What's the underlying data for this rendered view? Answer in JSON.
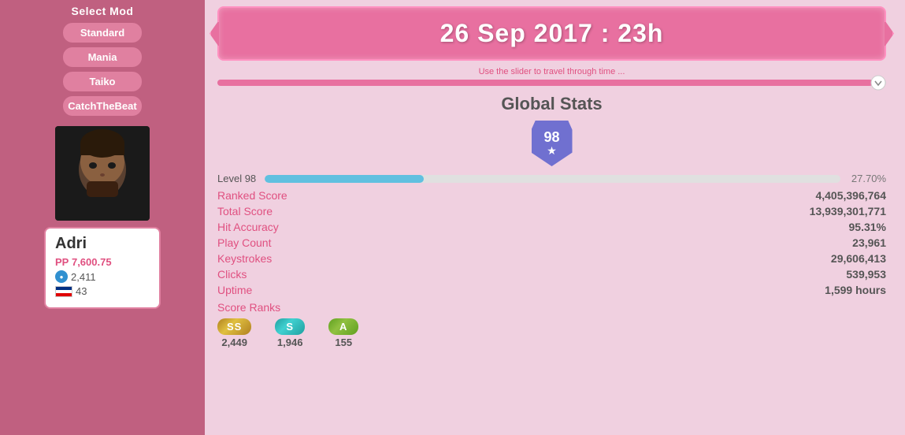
{
  "sidebar": {
    "mod_title": "Select Mod",
    "mod_buttons": [
      "Standard",
      "Mania",
      "Taiko",
      "CatchTheBeat"
    ],
    "user": {
      "name": "Adri",
      "pp_label": "PP",
      "pp_value": "7,600.75",
      "global_rank": "2,411",
      "country_rank": "43"
    }
  },
  "main": {
    "date_text": "26 Sep 2017 : 23h",
    "slider_hint": "Use the slider to travel through time ...",
    "section_title": "Global Stats",
    "level": {
      "number": "98",
      "label": "Level 98",
      "progress_pct": 27.7,
      "progress_text": "27.70%",
      "bar_width_pct": 27.7
    },
    "stats": [
      {
        "label": "Ranked Score",
        "value": "4,405,396,764"
      },
      {
        "label": "Total Score",
        "value": "13,939,301,771"
      },
      {
        "label": "Hit Accuracy",
        "value": "95.31%"
      },
      {
        "label": "Play Count",
        "value": "23,961"
      },
      {
        "label": "Keystrokes",
        "value": "29,606,413"
      },
      {
        "label": "Clicks",
        "value": "539,953"
      },
      {
        "label": "Uptime",
        "value": "1,599 hours"
      }
    ],
    "score_ranks": {
      "label": "Score Ranks",
      "items": [
        {
          "badge": "SS",
          "count": "2,449",
          "type": "ss"
        },
        {
          "badge": "S",
          "count": "1,946",
          "type": "s"
        },
        {
          "badge": "A",
          "count": "155",
          "type": "a"
        }
      ]
    }
  },
  "colors": {
    "primary": "#e870a0",
    "accent": "#60c0e0",
    "text_pink": "#e05080"
  }
}
